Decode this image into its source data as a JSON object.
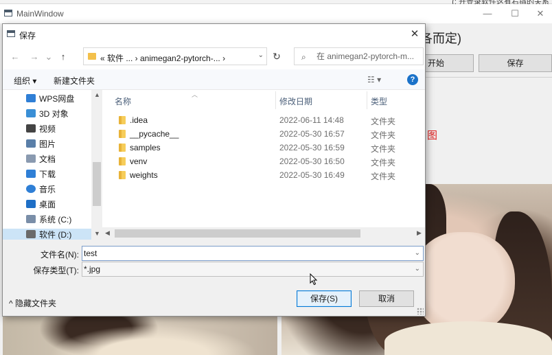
{
  "top_strip": {
    "text": "(: 升登录软件这有右插的关系"
  },
  "main_window": {
    "title": "MainWindow",
    "controls": {
      "minimize": "—",
      "maximize": "☐",
      "close": "✕"
    },
    "heading": "各而定)",
    "start_button": "开始",
    "save_button": "保存",
    "red_text": "图"
  },
  "dialog": {
    "title": "保存",
    "close": "✕",
    "nav": {
      "back": "←",
      "forward": "→",
      "recent": "⌄",
      "up": "↑",
      "breadcrumb": "« 软件 ... › animegan2-pytorch-... ›",
      "address_dropdown": "⌄",
      "refresh": "↻",
      "search_placeholder": "在 animegan2-pytorch-m..."
    },
    "commands": {
      "organize": "组织 ▾",
      "new_folder": "新建文件夹",
      "view": "☷ ▾",
      "help": "?"
    },
    "sidebar": {
      "items": [
        {
          "label": "WPS网盘",
          "icon": "cloud-icon",
          "color": "#2f7fd6"
        },
        {
          "label": "3D 对象",
          "icon": "cube-icon",
          "color": "#3a8fd6"
        },
        {
          "label": "视频",
          "icon": "film-icon",
          "color": "#444444"
        },
        {
          "label": "图片",
          "icon": "picture-icon",
          "color": "#5a7fa8"
        },
        {
          "label": "文档",
          "icon": "document-icon",
          "color": "#8a9ab0"
        },
        {
          "label": "下载",
          "icon": "download-arrow-icon",
          "color": "#2f7fd6"
        },
        {
          "label": "音乐",
          "icon": "music-note-icon",
          "color": "#2f7fd6"
        },
        {
          "label": "桌面",
          "icon": "desktop-icon",
          "color": "#1f6fc6"
        },
        {
          "label": "系统 (C:)",
          "icon": "drive-icon",
          "color": "#7a8ea8"
        },
        {
          "label": "软件 (D:)",
          "icon": "drive-icon",
          "color": "#6a6a6a",
          "selected": true
        }
      ]
    },
    "columns": {
      "name": "名称",
      "modified": "修改日期",
      "type": "类型"
    },
    "files": [
      {
        "name": ".idea",
        "modified": "2022-06-11 14:48",
        "type": "文件夹"
      },
      {
        "name": "__pycache__",
        "modified": "2022-05-30 16:57",
        "type": "文件夹"
      },
      {
        "name": "samples",
        "modified": "2022-05-30 16:59",
        "type": "文件夹"
      },
      {
        "name": "venv",
        "modified": "2022-05-30 16:50",
        "type": "文件夹"
      },
      {
        "name": "weights",
        "modified": "2022-05-30 16:49",
        "type": "文件夹"
      }
    ],
    "form": {
      "filename_label": "文件名(N):",
      "filename_value": "test",
      "filetype_label": "保存类型(T):",
      "filetype_value": "*.jpg",
      "dropdown": "⌄"
    },
    "hide_folders": "^ 隐藏文件夹",
    "save_button": "保存(S)",
    "cancel_button": "取消"
  },
  "colors": {
    "accent": "#0078d7",
    "selection": "#cce4f7",
    "folder": "#f3c04b",
    "help": "#1a72c9",
    "red_text": "#e02020"
  }
}
